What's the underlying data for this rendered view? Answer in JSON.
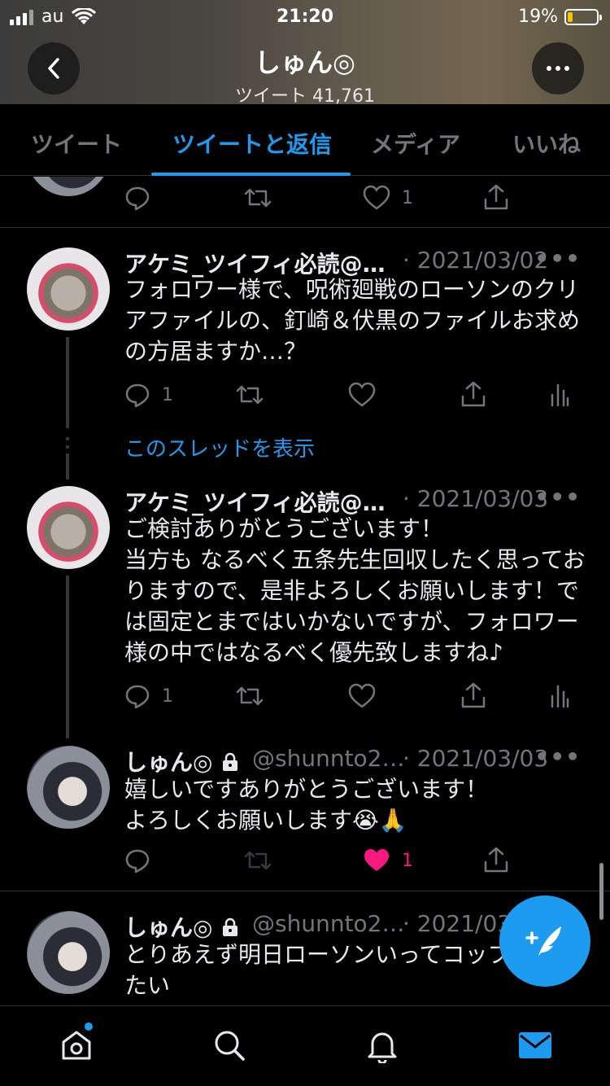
{
  "status_bar": {
    "carrier": "au",
    "time": "21:20",
    "battery": "19%",
    "battery_level": 0.19
  },
  "header": {
    "name": "しゅん◎",
    "tweet_count": "ツイート 41,761",
    "back_icon": "chevron-left-icon",
    "more_icon": "more-horizontal-icon"
  },
  "tabs": [
    {
      "label": "ツイート"
    },
    {
      "label": "ツイートと返信"
    },
    {
      "label": "メディア"
    },
    {
      "label": "いいね"
    }
  ],
  "feed": {
    "top_partial": {
      "like_count": "1"
    },
    "tweets": [
      {
        "name": "アケミ_ツイフィ必読@…",
        "date": "· 2021/03/02",
        "text": "フォロワー様で、呪術廻戦のローソンのクリアファイルの、釘崎＆伏黒のファイルお求めの方居ますか…？",
        "reply_count": "1"
      },
      {
        "name": "アケミ_ツイフィ必読@…",
        "date": "· 2021/03/03",
        "text_lines": [
          "ご検討ありがとうございます！",
          "当方も なるべく五条先生回収したく思っておりますので、是非よろしくお願いします！では固定とまではいかないですが、フォロワー様の中ではなるべく優先致しますね♪"
        ],
        "reply_count": "1"
      },
      {
        "name": "しゅん◎",
        "handle": "@shunnto2…",
        "date": "· 2021/03/03",
        "text_lines": [
          "嬉しいですありがとうございます！",
          "よろしくお願いします😭🙏"
        ],
        "like_count": "1"
      },
      {
        "name": "しゅん◎",
        "handle": "@shunnto2…",
        "date": "· 2021/03",
        "text": "とりあえず明日ローソンいってコップ\nたい"
      }
    ],
    "show_thread": "このスレッドを表示"
  },
  "colors": {
    "accent": "#1d9bf0",
    "like": "#f91880",
    "muted": "#71767b",
    "background": "#000000"
  },
  "bottom_nav": [
    {
      "icon": "home-icon"
    },
    {
      "icon": "search-icon"
    },
    {
      "icon": "bell-icon"
    },
    {
      "icon": "mail-icon"
    }
  ]
}
